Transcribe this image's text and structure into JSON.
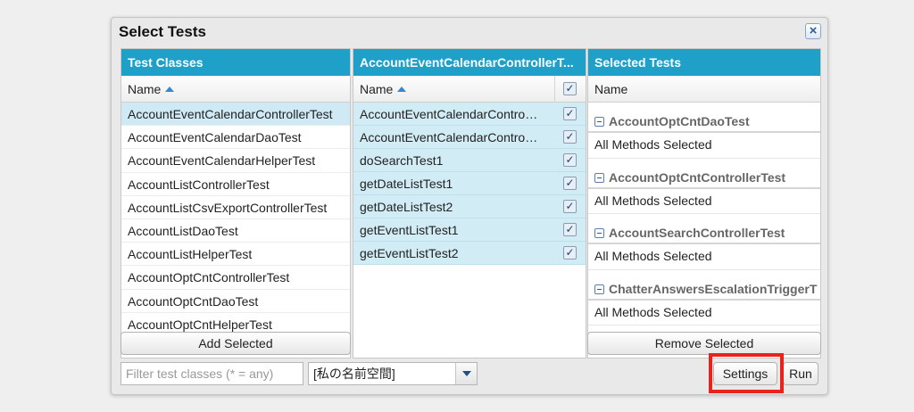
{
  "dialog": {
    "title": "Select Tests",
    "close_symbol": "×"
  },
  "test_classes": {
    "header": "Test Classes",
    "column": "Name",
    "items": [
      "AccountEventCalendarControllerTest",
      "AccountEventCalendarDaoTest",
      "AccountEventCalendarHelperTest",
      "AccountListControllerTest",
      "AccountListCsvExportControllerTest",
      "AccountListDaoTest",
      "AccountListHelperTest",
      "AccountOptCntControllerTest",
      "AccountOptCntDaoTest",
      "AccountOptCntHelperTest"
    ],
    "add_button": "Add Selected"
  },
  "methods": {
    "header": "AccountEventCalendarControllerT...",
    "column": "Name",
    "items": [
      "AccountEventCalendarControll...",
      "AccountEventCalendarControll...",
      "doSearchTest1",
      "getDateListTest1",
      "getDateListTest2",
      "getEventListTest1",
      "getEventListTest2"
    ],
    "check_symbol": "✓"
  },
  "selected_tests": {
    "header": "Selected Tests",
    "column": "Name",
    "groups": [
      {
        "name": "AccountOptCntDaoTest",
        "body": "All Methods Selected"
      },
      {
        "name": "AccountOptCntControllerTest",
        "body": "All Methods Selected"
      },
      {
        "name": "AccountSearchControllerTest",
        "body": "All Methods Selected"
      },
      {
        "name": "ChatterAnswersEscalationTriggerT",
        "body": "All Methods Selected"
      }
    ],
    "remove_button": "Remove Selected"
  },
  "footer": {
    "filter_placeholder": "Filter test classes (* = any)",
    "namespace_value": "[私の名前空間]",
    "settings_button": "Settings",
    "run_button": "Run"
  },
  "colors": {
    "accent": "#1fa0c8",
    "selected_row": "#cfeaf4",
    "highlight": "#e8231c"
  }
}
